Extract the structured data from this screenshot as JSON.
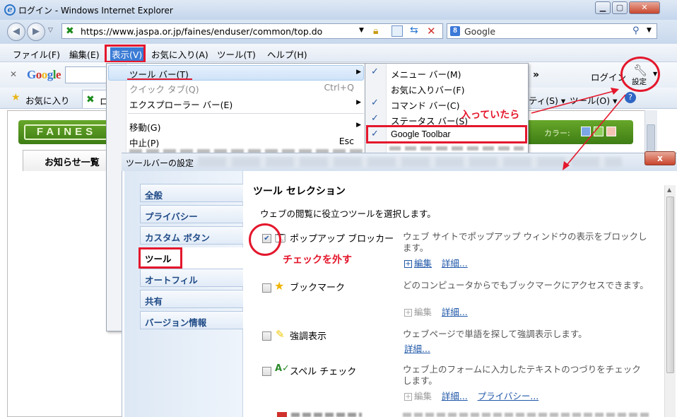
{
  "window": {
    "title": "ログイン - Windows Internet Explorer"
  },
  "address": {
    "url": "https://www.jaspa.or.jp/faines/enduser/common/top.do",
    "search_placeholder": "Google"
  },
  "menubar": [
    "ファイル(F)",
    "編集(E)",
    "表示(V)",
    "お気に入り(A)",
    "ツール(T)",
    "ヘルプ(H)"
  ],
  "google_toolbar": {
    "logo": "Google",
    "login": "ログイン",
    "settings": "設定",
    "more": "»"
  },
  "favorites": {
    "label": "お気に入り",
    "tab_fragment": "ロ",
    "page_menu": "ティ(S) ▾",
    "tools_menu": "ツール(O) ▾"
  },
  "page": {
    "logo": "FAINES",
    "color_label": "カラー:",
    "notice_tab": "お知らせ一覧"
  },
  "view_menu": {
    "items": [
      {
        "label": "ツール バー(T)",
        "shortcut": "",
        "arrow": "▶",
        "disabled": false
      },
      {
        "label": "クイック タブ(Q)",
        "shortcut": "Ctrl+Q",
        "arrow": "",
        "disabled": true
      },
      {
        "label": "エクスプローラー バー(E)",
        "shortcut": "",
        "arrow": "▶",
        "disabled": false
      },
      {
        "label": "移動(G)",
        "shortcut": "",
        "arrow": "▶",
        "disabled": false
      },
      {
        "label": "中止(P)",
        "shortcut": "Esc",
        "arrow": "",
        "disabled": false
      }
    ]
  },
  "toolbar_submenu": {
    "items": [
      {
        "label": "メニュー バー(M)",
        "checked": true
      },
      {
        "label": "お気に入りバー(F)",
        "checked": false
      },
      {
        "label": "コマンド バー(C)",
        "checked": true
      },
      {
        "label": "ステータス バー(S)",
        "checked": true
      },
      {
        "label": "Google Toolbar",
        "checked": true
      }
    ]
  },
  "dialog": {
    "title": "ツールバーの設定",
    "close": "x",
    "tabs": [
      "全般",
      "プライバシー",
      "カスタム ボタン",
      "ツール",
      "オートフィル",
      "共有",
      "バージョン情報"
    ],
    "heading": "ツール セレクション",
    "subheading": "ウェブの閲覧に役立つツールを選択します。",
    "tools": [
      {
        "name": "ポップアップ ブロッカー",
        "desc": "ウェブ サイトでポップアップ ウィンドウの表示をブロックします。",
        "links": [
          "編集",
          "詳細..."
        ],
        "checked": true
      },
      {
        "name": "ブックマーク",
        "desc": "どのコンピュータからでもブックマークにアクセスできます。",
        "links": [
          "編集",
          "詳細..."
        ],
        "checked": false
      },
      {
        "name": "強調表示",
        "desc": "ウェブページで単語を探して強調表示します。",
        "links": [
          "詳細..."
        ],
        "checked": false
      },
      {
        "name": "スペル チェック",
        "desc": "ウェブ上のフォームに入力したテキストのつづりをチェック します。",
        "links": [
          "編集",
          "詳細...",
          "プライバシー..."
        ],
        "checked": false
      }
    ]
  },
  "annotations": {
    "entered": "入っていたら",
    "uncheck": "チェックを外す"
  },
  "colors": {
    "annotation": "#e4172c",
    "faines_green": "#4f921d",
    "link": "#1f57a8"
  }
}
